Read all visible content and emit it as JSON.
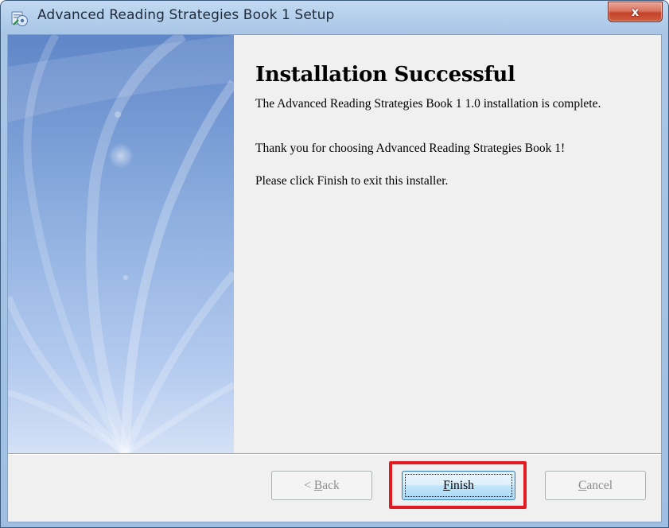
{
  "window": {
    "title": "Advanced Reading Strategies Book 1 Setup",
    "icon": "setup-installer-icon",
    "close_icon": "close-icon",
    "close_glyph": "x"
  },
  "content": {
    "heading": "Installation Successful",
    "paragraph1": "The Advanced Reading Strategies Book 1 1.0 installation is complete.",
    "paragraph2": "Thank you for choosing Advanced Reading Strategies Book 1!",
    "paragraph3": "Please click Finish to exit this installer."
  },
  "buttons": {
    "back": {
      "prefix": "< ",
      "mnemonic": "B",
      "rest": "ack",
      "enabled": false
    },
    "finish": {
      "mnemonic": "F",
      "rest": "inish",
      "enabled": true,
      "focused": true
    },
    "cancel": {
      "mnemonic": "C",
      "rest": "ancel",
      "enabled": false
    }
  },
  "colors": {
    "highlight_box": "#e21b23",
    "title_bar": "#a9c6e6",
    "close_button": "#c4442b"
  }
}
